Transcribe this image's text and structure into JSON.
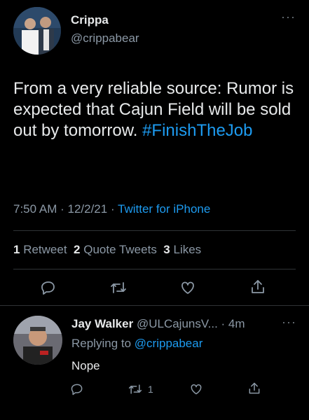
{
  "tweet": {
    "author_name": "Crippa",
    "author_handle": "@crippabear",
    "text_main": "From a very reliable source: Rumor is expected that Cajun Field will be sold out by tomorrow. ",
    "hashtag": "#FinishTheJob",
    "time": "7:50 AM",
    "date": "12/2/21",
    "source": "Twitter for iPhone",
    "retweet_count": "1",
    "retweet_label": "Retweet",
    "quote_count": "2",
    "quote_label": "Quote Tweets",
    "like_count": "3",
    "like_label": "Likes"
  },
  "reply": {
    "author_name": "Jay Walker",
    "author_handle": "@ULCajunsV...",
    "time_ago": "4m",
    "replying_prefix": "Replying to",
    "replying_handle": "@crippabear",
    "text": "Nope",
    "retweet_count": "1"
  },
  "icons": [
    "reply-icon",
    "retweet-icon",
    "like-icon",
    "share-icon",
    "more-icon"
  ],
  "colors": {
    "background": "#000000",
    "text": "#e7e9ea",
    "muted": "#8b98a5",
    "link": "#1d9bf0",
    "divider": "#2f3336"
  }
}
